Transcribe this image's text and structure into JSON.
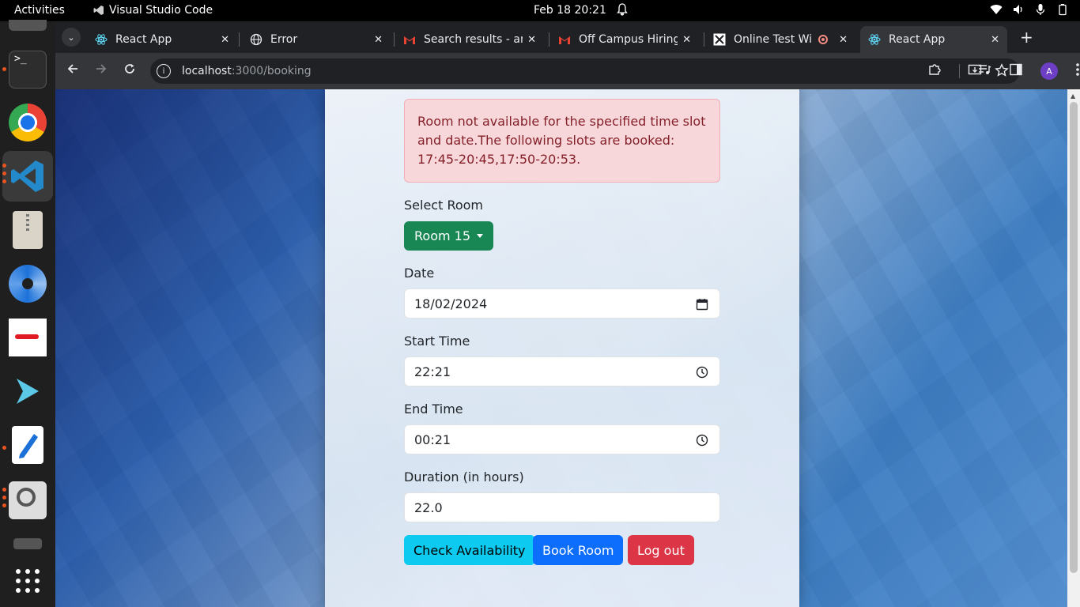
{
  "topbar": {
    "activities": "Activities",
    "app_name": "Visual Studio Code",
    "clock": "Feb 18  20:21"
  },
  "browser": {
    "tabs": [
      {
        "title": "React App",
        "icon": "react-icon"
      },
      {
        "title": "Error",
        "icon": "globe-icon"
      },
      {
        "title": "Search results - am",
        "icon": "gmail-icon"
      },
      {
        "title": "Off Campus Hiring",
        "icon": "gmail-icon"
      },
      {
        "title": "Online Test Wi",
        "icon": "test-site-icon"
      },
      {
        "title": "React App",
        "icon": "react-icon",
        "active": true
      }
    ],
    "url_host": "localhost",
    "url_path": ":3000/booking",
    "profile_initial": "A"
  },
  "booking": {
    "alert_text": "Room not available for the specified time slot and date.The following slots are booked: 17:45-20:45,17:50-20:53.",
    "select_room_label": "Select Room",
    "room_selected": "Room 15",
    "date_label": "Date",
    "date_value": "18/02/2024",
    "start_label": "Start Time",
    "start_value": "22:21",
    "end_label": "End Time",
    "end_value": "00:21",
    "duration_label": "Duration (in hours)",
    "duration_value": "22.0",
    "check_button": "Check Availability",
    "book_button": "Book Room",
    "logout_button": "Log out"
  },
  "colors": {
    "success": "#198754",
    "info": "#0dcaf0",
    "primary": "#0d6efd",
    "danger": "#dc3545",
    "alert_bg": "#f8d7da",
    "alert_text": "#842029"
  }
}
